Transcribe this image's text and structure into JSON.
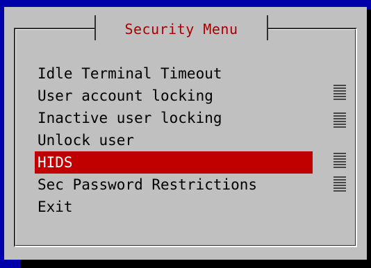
{
  "dialog": {
    "title": "Security Menu",
    "menu_items": [
      {
        "label": "Idle Terminal Timeout",
        "selected": false
      },
      {
        "label": "User account locking",
        "selected": false
      },
      {
        "label": "Inactive user locking",
        "selected": false
      },
      {
        "label": "Unlock user",
        "selected": false
      },
      {
        "label": "HIDS",
        "selected": true
      },
      {
        "label": "Sec Password Restrictions",
        "selected": false
      },
      {
        "label": "Exit",
        "selected": false
      }
    ]
  },
  "colors": {
    "background": "#0000aa",
    "dialog": "#c0c0c0",
    "title_text": "#a80000",
    "selection": "#c00000",
    "selection_text": "#ffffff"
  },
  "icons": {
    "scroll_indicator": "scrollbar-indicator-icon"
  }
}
